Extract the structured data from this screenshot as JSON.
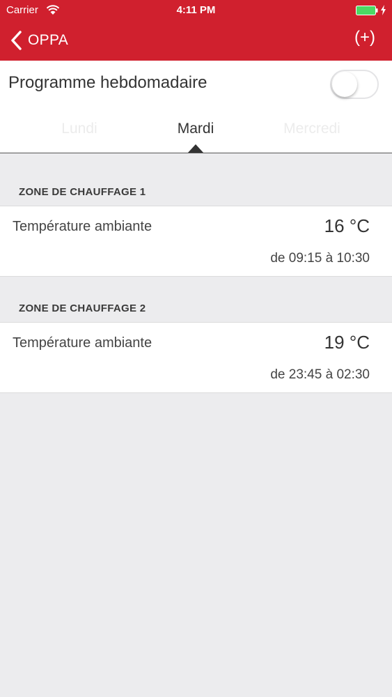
{
  "status_bar": {
    "carrier": "Carrier",
    "time": "4:11 PM"
  },
  "nav": {
    "back_label": "OPPA",
    "add_label": "(+)"
  },
  "program": {
    "title": "Programme hebdomadaire",
    "enabled": false
  },
  "days": {
    "prev": "Lundi",
    "current": "Mardi",
    "next": "Mercredi"
  },
  "zones": [
    {
      "header": "ZONE DE CHAUFFAGE 1",
      "label": "Température ambiante",
      "temperature": "16 °C",
      "time_range": "de 09:15 à 10:30"
    },
    {
      "header": "ZONE DE CHAUFFAGE 2",
      "label": "Température ambiante",
      "temperature": "19 °C",
      "time_range": "de 23:45 à 02:30"
    }
  ],
  "colors": {
    "brand": "#d0202e",
    "background": "#ececee",
    "battery": "#4cd964"
  }
}
